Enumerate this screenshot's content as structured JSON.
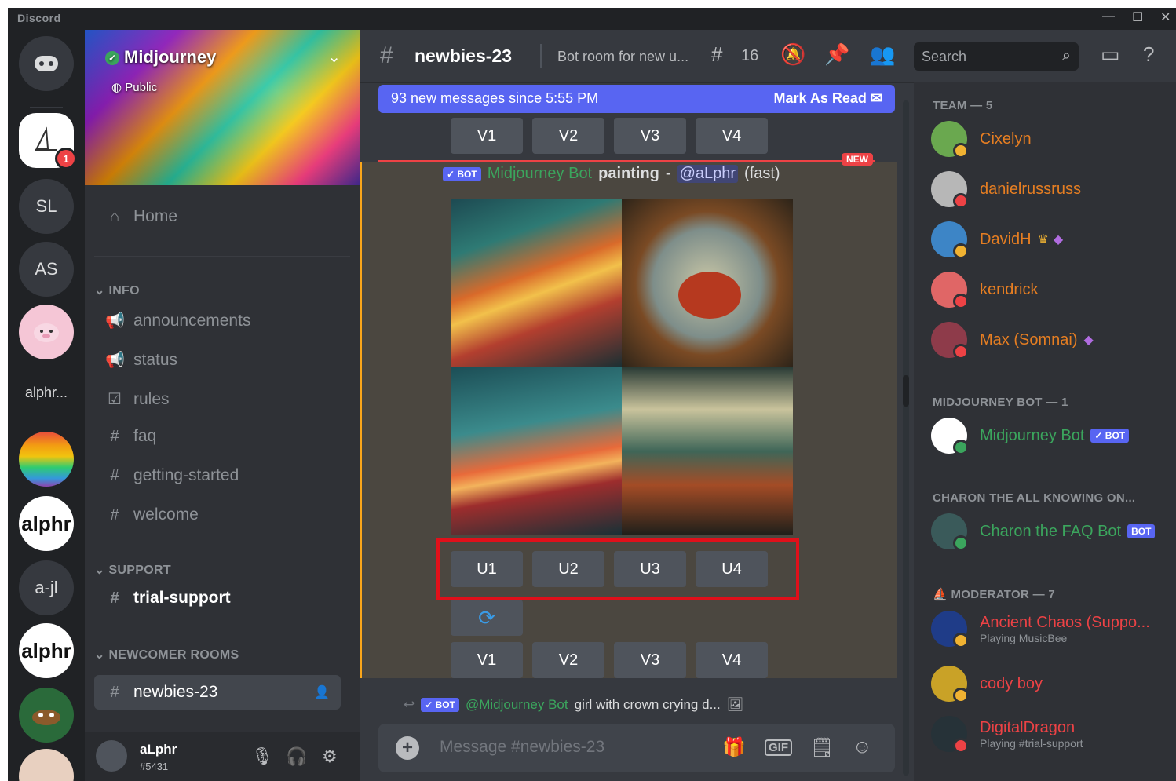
{
  "window": {
    "app_name": "Discord",
    "min": "—",
    "max": "☐",
    "close": "✕"
  },
  "rail": {
    "servers": [
      {
        "label": "SL"
      },
      {
        "label": "AS"
      },
      {
        "label": "alphr..."
      },
      {
        "label": "alphr"
      },
      {
        "label": "a-jl"
      },
      {
        "label": "alphr"
      }
    ],
    "badge": "1"
  },
  "server": {
    "name": "Midjourney",
    "visibility": "Public"
  },
  "sidebar": {
    "home": "Home",
    "categories": {
      "info": "INFO",
      "support": "SUPPORT",
      "newcomer": "NEWCOMER ROOMS"
    },
    "info_channels": [
      {
        "label": "announcements",
        "icon": "megaphone-icon"
      },
      {
        "label": "status",
        "icon": "megaphone-icon"
      },
      {
        "label": "rules",
        "icon": "checkbox-icon"
      },
      {
        "label": "faq",
        "icon": "hash-icon"
      },
      {
        "label": "getting-started",
        "icon": "hash-icon"
      },
      {
        "label": "welcome",
        "icon": "hash-icon"
      }
    ],
    "support_channel": "trial-support",
    "active_channel": "newbies-23"
  },
  "user": {
    "name": "aLphr",
    "discriminator": "#5431"
  },
  "header": {
    "channel": "newbies-23",
    "topic": "Bot room for new u...",
    "threads_count": "16",
    "search_placeholder": "Search"
  },
  "new_bar": {
    "text": "93 new messages since 5:55 PM",
    "action": "Mark As Read"
  },
  "top_buttons": [
    "V1",
    "V2",
    "V3",
    "V4"
  ],
  "new_tag": "NEW",
  "message": {
    "bot_tag": "✓ BOT",
    "author": "Midjourney Bot",
    "prompt": "painting",
    "dash": "-",
    "mention": "@aLphr",
    "speed": "(fast)"
  },
  "upscale_buttons": [
    "U1",
    "U2",
    "U3",
    "U4"
  ],
  "variation_buttons": [
    "V1",
    "V2",
    "V3",
    "V4"
  ],
  "reply": {
    "bot_tag": "✓ BOT",
    "mention": "@Midjourney Bot",
    "text": "girl with crown crying d..."
  },
  "composer": {
    "placeholder": "Message #newbies-23",
    "gif": "GIF"
  },
  "members": {
    "groups": [
      {
        "title": "TEAM — 5"
      },
      {
        "title": "MIDJOURNEY BOT — 1"
      },
      {
        "title": "CHARON THE ALL KNOWING ON..."
      },
      {
        "title": "MODERATOR — 7"
      }
    ],
    "team": [
      "Cixelyn",
      "danielrussruss",
      "DavidH",
      "kendrick",
      "Max (Somnai)"
    ],
    "bot": {
      "name": "Midjourney Bot",
      "tag": "✓ BOT"
    },
    "charon": {
      "name": "Charon the FAQ Bot",
      "tag": "BOT"
    },
    "moderators": [
      {
        "name": "Ancient Chaos (Suppo...",
        "sub": "Playing MusicBee"
      },
      {
        "name": "cody boy",
        "sub": ""
      },
      {
        "name": "DigitalDragon",
        "sub": "Playing #trial-support"
      }
    ]
  }
}
